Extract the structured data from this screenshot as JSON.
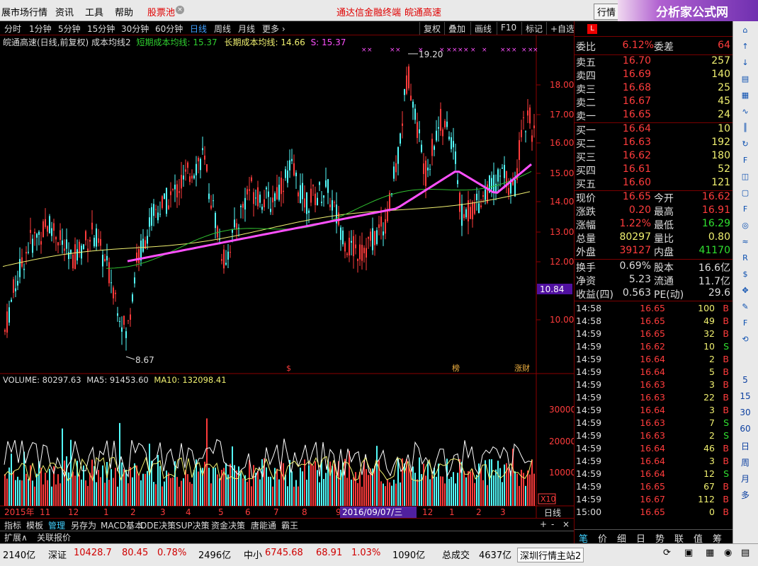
{
  "menubar": {
    "items": [
      "展市场行情",
      "资讯",
      "工具",
      "帮助"
    ],
    "stockpool": "股票池",
    "center1": "通达信金融终端",
    "center2": "皖通高速",
    "right_btn": "行情",
    "logo": "分析家公式网",
    "logo_url": "www.88gs.com"
  },
  "toolbar": {
    "periods": [
      "分时",
      "1分钟",
      "5分钟",
      "15分钟",
      "30分钟",
      "60分钟",
      "日线",
      "周线",
      "月线",
      "更多 ›"
    ],
    "active": "日线",
    "right": [
      "复权",
      "叠加",
      "画线",
      "F10",
      "标记",
      "+自选"
    ]
  },
  "legend": {
    "name": "皖通高速(日线,前复权) 成本均线2",
    "short_label": "短期成本均线: 15.37",
    "long_label": "长期成本均线: 14.66",
    "s_label": "S: 15.37"
  },
  "vol_legend": {
    "volume": "VOLUME: 80297.63",
    "ma5": "MA5: 91453.60",
    "ma10": "MA10: 132098.41"
  },
  "colors": {
    "up": "#ff3c3c",
    "down": "#54fcfc",
    "short": "#ff50ff",
    "long": "#f0f070",
    "mid": "#30c030",
    "grid": "#8b0000"
  },
  "chart_data": {
    "type": "candlestick",
    "price_axis": [
      "18.00",
      "17.00",
      "16.00",
      "15.00",
      "14.00",
      "13.00",
      "12.00",
      "10.00"
    ],
    "ylim": [
      8.0,
      20.0
    ],
    "current_price_tag": "10.84",
    "high_label": "19.20",
    "low_label": "8.67",
    "vol_axis": [
      "30000",
      "20000",
      "10000"
    ],
    "vol_unit": "X10",
    "x_labels": [
      "2015年",
      "11",
      "12",
      "1",
      "2",
      "3",
      "4",
      "5",
      "6",
      "7",
      "8",
      "9",
      "10",
      "11",
      "12",
      "1",
      "2",
      "3"
    ],
    "cursor_date": "2016/09/07/三",
    "period_label": "日线",
    "markers": [
      "$",
      "榜",
      "涨财"
    ],
    "legend_short": "短期成本均线",
    "legend_long": "长期成本均线"
  },
  "bottom_tabs": {
    "items": [
      "指标",
      "模板",
      "管理",
      "另存为",
      "MACD基本",
      "DDE决策",
      "SUP决策",
      "资金决策",
      "唐能通",
      "霸王"
    ],
    "active": "管理",
    "second": [
      "扩展∧",
      "关联报价"
    ]
  },
  "quote": {
    "wb": {
      "label": "委比",
      "value": "6.12%",
      "label2": "委差",
      "value2": "64"
    },
    "sell": [
      {
        "l": "卖五",
        "p": "16.70",
        "v": "257"
      },
      {
        "l": "卖四",
        "p": "16.69",
        "v": "140"
      },
      {
        "l": "卖三",
        "p": "16.68",
        "v": "25"
      },
      {
        "l": "卖二",
        "p": "16.67",
        "v": "45"
      },
      {
        "l": "卖一",
        "p": "16.65",
        "v": "24"
      }
    ],
    "buy": [
      {
        "l": "买一",
        "p": "16.64",
        "v": "10"
      },
      {
        "l": "买二",
        "p": "16.63",
        "v": "192"
      },
      {
        "l": "买三",
        "p": "16.62",
        "v": "180"
      },
      {
        "l": "买四",
        "p": "16.61",
        "v": "52"
      },
      {
        "l": "买五",
        "p": "16.60",
        "v": "121"
      }
    ],
    "info": [
      [
        "现价",
        "16.65",
        "今开",
        "16.62"
      ],
      [
        "涨跌",
        "0.20",
        "最高",
        "16.91"
      ],
      [
        "涨幅",
        "1.22%",
        "最低",
        "16.29"
      ],
      [
        "总量",
        "80297",
        "量比",
        "0.80"
      ],
      [
        "外盘",
        "39127",
        "内盘",
        "41170"
      ],
      [
        "换手",
        "0.69%",
        "股本",
        "16.6亿"
      ],
      [
        "净资",
        "5.23",
        "流通",
        "11.7亿"
      ],
      [
        "收益(四)",
        "0.563",
        "PE(动)",
        "29.6"
      ]
    ],
    "ticks": [
      [
        "14:58",
        "16.65",
        "100",
        "B"
      ],
      [
        "14:58",
        "16.65",
        "49",
        "B"
      ],
      [
        "14:59",
        "16.65",
        "32",
        "B"
      ],
      [
        "14:59",
        "16.62",
        "10",
        "S"
      ],
      [
        "14:59",
        "16.64",
        "2",
        "B"
      ],
      [
        "14:59",
        "16.64",
        "5",
        "B"
      ],
      [
        "14:59",
        "16.63",
        "3",
        "B"
      ],
      [
        "14:59",
        "16.63",
        "22",
        "B"
      ],
      [
        "14:59",
        "16.64",
        "3",
        "B"
      ],
      [
        "14:59",
        "16.63",
        "7",
        "S"
      ],
      [
        "14:59",
        "16.63",
        "2",
        "S"
      ],
      [
        "14:59",
        "16.64",
        "46",
        "B"
      ],
      [
        "14:59",
        "16.64",
        "3",
        "B"
      ],
      [
        "14:59",
        "16.64",
        "12",
        "S"
      ],
      [
        "14:59",
        "16.65",
        "67",
        "B"
      ],
      [
        "14:59",
        "16.67",
        "112",
        "B"
      ],
      [
        "15:00",
        "16.65",
        "0",
        "B"
      ]
    ],
    "bottom_tabs": [
      "笔",
      "价",
      "细",
      "日",
      "势",
      "联",
      "值",
      "筹"
    ]
  },
  "status": {
    "s1": "2140亿",
    "s2_label": "深证",
    "s2_val": "10428.7",
    "s2_chg": "80.45",
    "s2_pct": "0.78%",
    "s2_amt": "2496亿",
    "s3_label": "中小",
    "s3_val": "6745.68",
    "s3_chg": "68.91",
    "s3_pct": "1.03%",
    "s3_amt": "1090亿",
    "s4_label": "总成交",
    "s4_val": "4637亿",
    "s5": "深圳行情主站2"
  },
  "sidebar": {
    "items": [
      "5",
      "15",
      "30",
      "60",
      "日",
      "周",
      "月",
      "多"
    ]
  }
}
